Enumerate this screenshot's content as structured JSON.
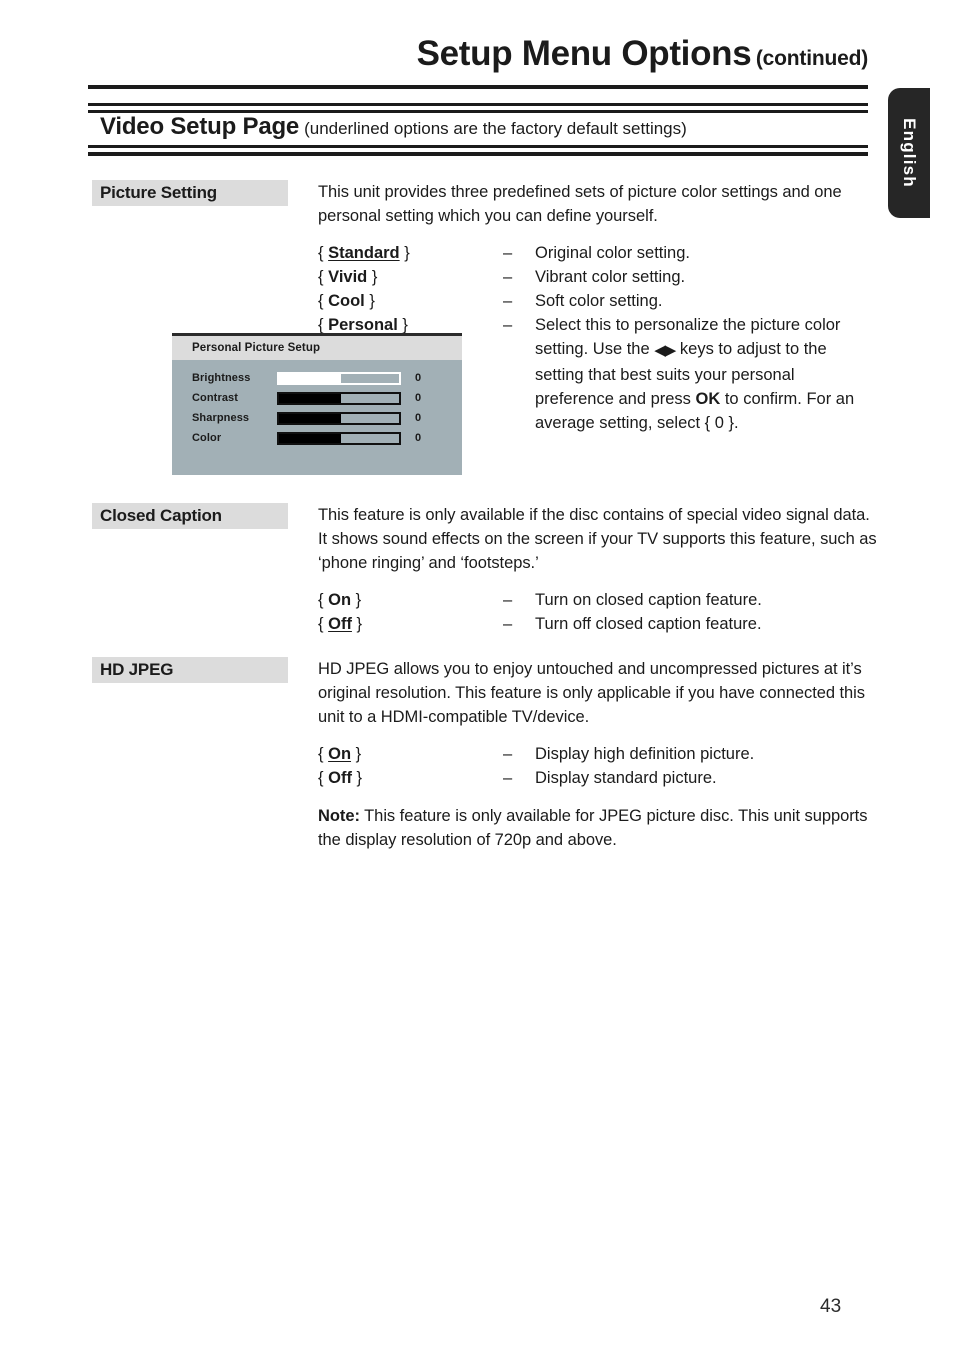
{
  "header": {
    "chapter_title": "Setup Menu Options",
    "chapter_suffix": "(continued)",
    "section_title": "Video Setup Page",
    "section_note": "(underlined options are the factory default settings)",
    "language_tab": "English"
  },
  "entries": [
    {
      "label": "Picture Setting",
      "intro": "This unit provides three predefined sets of picture color settings and one personal setting which you can define yourself.",
      "options": [
        {
          "open": "{",
          "value": "Standard",
          "close": "}",
          "underlined": true,
          "dash": "–",
          "desc": "Original color setting."
        },
        {
          "open": "{",
          "value": "Vivid",
          "close": "}",
          "underlined": false,
          "dash": "–",
          "desc": "Vibrant color setting."
        },
        {
          "open": "{",
          "value": "Cool",
          "close": "}",
          "underlined": false,
          "dash": "–",
          "desc": "Soft color setting."
        },
        {
          "open": "{",
          "value": "Personal",
          "close": "}",
          "underlined": false,
          "dash": "–",
          "desc_part1": "Select this to personalize the picture color setting. Use the ",
          "arrows": "◀▶",
          "desc_part2": " keys to adjust to the setting that best suits your personal preference and press ",
          "desc_bold": "OK",
          "desc_part3": " to confirm. For an average setting, select { 0 }."
        }
      ]
    },
    {
      "label": "Closed Caption",
      "intro": "This feature is only available if the disc contains of special video signal data. It shows sound effects on the screen if your TV supports this feature, such as ‘phone ringing’ and ‘footsteps.’",
      "options": [
        {
          "open": "{",
          "value": "On",
          "close": "}",
          "underlined": false,
          "dash": "–",
          "desc": "Turn on closed caption feature."
        },
        {
          "open": "{",
          "value": "Off",
          "close": "}",
          "underlined": true,
          "dash": "–",
          "desc": "Turn off closed caption feature."
        }
      ]
    },
    {
      "label": "HD JPEG",
      "intro": "HD JPEG allows you to enjoy untouched and uncompressed pictures at it’s original resolution. This feature is only applicable if you have connected this unit to a HDMI-compatible TV/device.",
      "options": [
        {
          "open": "{",
          "value": "On",
          "close": "}",
          "underlined": true,
          "dash": "–",
          "desc": "Display high definition picture."
        },
        {
          "open": "{",
          "value": "Off",
          "close": "}",
          "underlined": false,
          "dash": "–",
          "desc": "Display standard picture."
        }
      ],
      "note_label": "Note:",
      "note_text": " This feature is only available for JPEG picture disc. This unit supports the display resolution of 720p and above."
    }
  ],
  "osd": {
    "title": "Personal Picture Setup",
    "rows": [
      {
        "name": "Brightness",
        "value": "0",
        "fill_percent": 52,
        "style": "light"
      },
      {
        "name": "Contrast",
        "value": "0",
        "fill_percent": 52,
        "style": "dark"
      },
      {
        "name": "Sharpness",
        "value": "0",
        "fill_percent": 52,
        "style": "dark"
      },
      {
        "name": "Color",
        "value": "0",
        "fill_percent": 52,
        "style": "dark"
      }
    ]
  },
  "footer": {
    "page_number": "43"
  }
}
